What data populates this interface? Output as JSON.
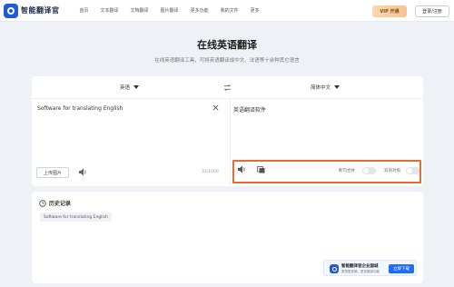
{
  "app": {
    "name": "智能翻译官",
    "brand_color": "#1f5bd8"
  },
  "nav": {
    "items": [
      {
        "label": "首页"
      },
      {
        "label": "文本翻译"
      },
      {
        "label": "文档翻译"
      },
      {
        "label": "图片翻译"
      },
      {
        "label": "更多功能"
      },
      {
        "label": "我的文件"
      },
      {
        "label": "更多"
      }
    ],
    "vip_label": "VIP 开通",
    "login_label": "登录/注册"
  },
  "heading": {
    "title": "在线英语翻译",
    "subtitle": "在线英语翻译工具，可将英语翻译成中文、法语等十余种其它语言"
  },
  "translator": {
    "source_lang": "英语",
    "target_lang": "简体中文",
    "source_text": "Software for translating English",
    "target_text": "英语翻译软件",
    "upload_label": "上传图片",
    "char_count": "32/1000",
    "toggle_1_label": "断句合并",
    "toggle_1_on": false,
    "toggle_2_label": "双语对照",
    "toggle_2_on": false,
    "highlight_color": "#e86b2f"
  },
  "history": {
    "title": "历史记录",
    "items": [
      "Software for translating English"
    ]
  },
  "promo": {
    "title": "智能翻译官企业国城",
    "subtitle": "更快更准确，更多翻译功能",
    "button_label": "立即下载",
    "button_color": "#1f6bff"
  }
}
